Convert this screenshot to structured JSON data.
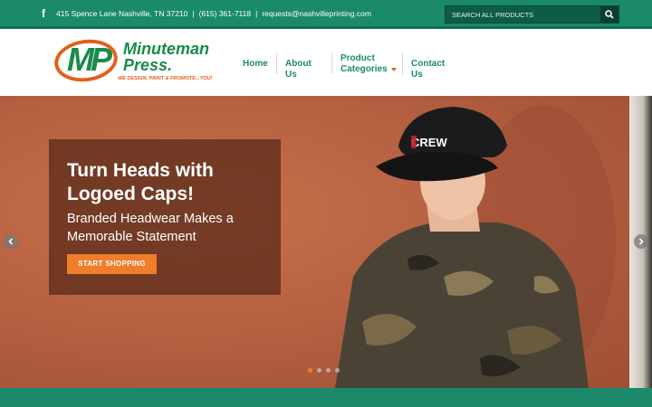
{
  "topbar": {
    "facebook_icon": "facebook-icon",
    "address": "415 Spence Lane Nashville, TN 37210",
    "phone": "(615) 361-7118",
    "email": "requests@nashvilleprinting.com",
    "separator": "|",
    "search_placeholder": "SEARCH ALL PRODUCTS",
    "search_icon": "search-icon",
    "color": "#1a8a6a"
  },
  "logo": {
    "monogram": "MP",
    "name_line1": "Minuteman",
    "name_line2": "Press.",
    "tagline": "WE DESIGN, PRINT & PROMOTE...YOU!",
    "brand_green": "#1a8a4a",
    "brand_orange": "#e35f1c"
  },
  "nav": {
    "home": "Home",
    "about": "About Us",
    "product_line1": "Product",
    "product_line2": "Categories",
    "contact": "Contact Us"
  },
  "hero": {
    "title": "Turn Heads with Logoed Caps!",
    "subtitle": "Branded Headwear Makes a Memorable Statement",
    "button": "START SHOPPING",
    "cap_text": "CREW",
    "button_color": "#ef7d2b",
    "slide_count": 4,
    "active_slide": 1
  }
}
